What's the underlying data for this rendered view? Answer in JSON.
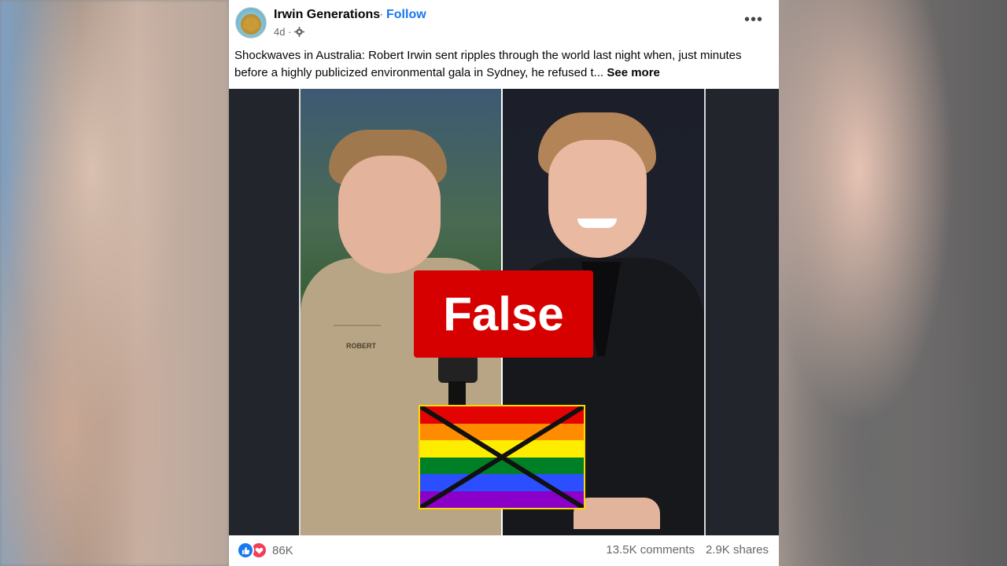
{
  "post": {
    "page_name": "Irwin Generations",
    "separator": "·",
    "follow_label": "Follow",
    "time": "4d ·",
    "audience_icon": "gear-icon",
    "more_icon": "•••",
    "text": "Shockwaves in Australia: Robert Irwin sent ripples through the world last night when, just minutes before a highly publicized environmental gala in Sydney, he refused t...",
    "see_more_label": "See more"
  },
  "media": {
    "badge_label": "False",
    "shirt_name": "ROBERT",
    "flag_colors": [
      "#e40303",
      "#ff8c00",
      "#ffed00",
      "#008026",
      "#2b4eff",
      "#8b00c9"
    ],
    "badge_color": "#d70000"
  },
  "footer": {
    "reaction_icons": [
      "like-icon",
      "love-icon"
    ],
    "reaction_count": "86K",
    "comments": "13.5K comments",
    "shares": "2.9K shares"
  }
}
